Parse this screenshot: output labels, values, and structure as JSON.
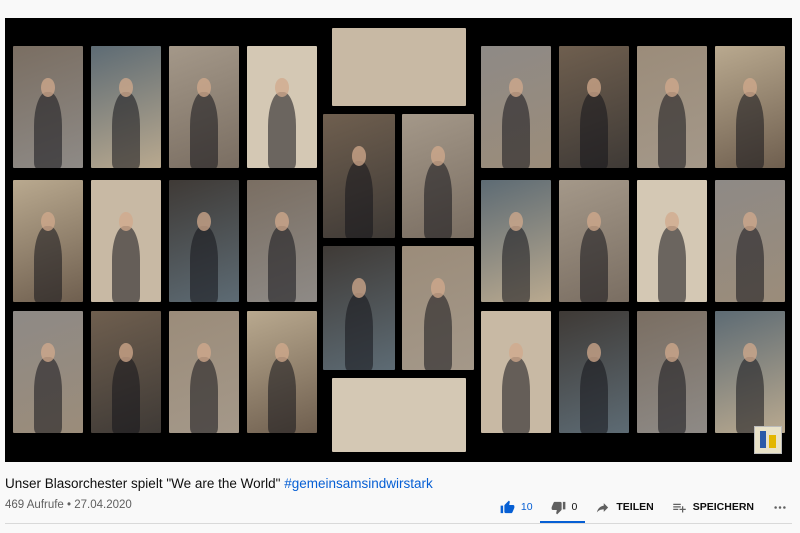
{
  "video": {
    "title_main": "Unser Blasorchester spielt \"We are the World\" ",
    "title_hashtag": "#gemeinsamsindwirstark",
    "views": "469 Aufrufe",
    "separator": " • ",
    "date": "27.04.2020"
  },
  "actions": {
    "like_count": "10",
    "dislike_count": "0",
    "share_label": "TEILEN",
    "save_label": "SPEICHERN"
  },
  "colors": {
    "link": "#065fd4",
    "player_bg": "#000000",
    "tile_palette": [
      "#7a6e62",
      "#b9a98f",
      "#8e8a86",
      "#5d6b74",
      "#c8b9a4",
      "#6f5f4f",
      "#a49889",
      "#3f3a36",
      "#9b8c7a",
      "#d4c8b4"
    ]
  },
  "icons": [
    "thumbs-up-icon",
    "thumbs-down-icon",
    "share-icon",
    "playlist-add-icon",
    "more-icon"
  ]
}
